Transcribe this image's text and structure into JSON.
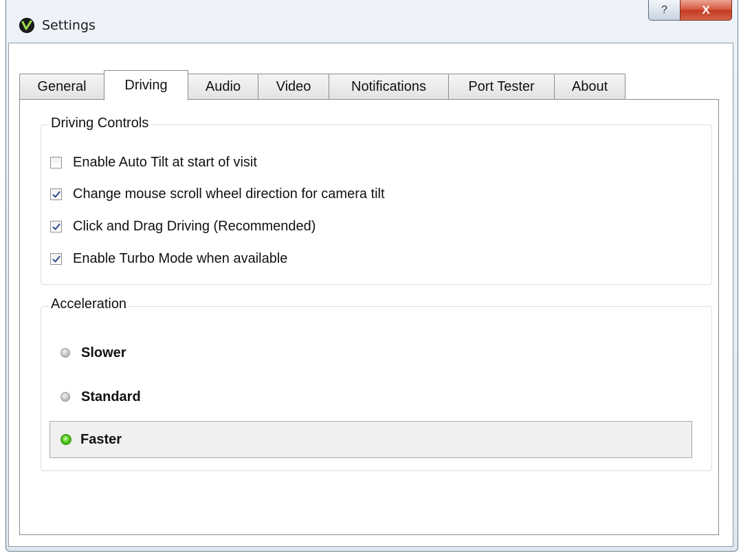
{
  "window": {
    "title": "Settings",
    "help_label": "?",
    "close_label": "X"
  },
  "tabs": [
    {
      "label": "General",
      "active": false
    },
    {
      "label": "Driving",
      "active": true
    },
    {
      "label": "Audio",
      "active": false
    },
    {
      "label": "Video",
      "active": false
    },
    {
      "label": "Notifications",
      "active": false
    },
    {
      "label": "Port Tester",
      "active": false
    },
    {
      "label": "About",
      "active": false
    }
  ],
  "driving_controls": {
    "title": "Driving Controls",
    "options": [
      {
        "label": "Enable Auto Tilt at start of visit",
        "checked": false
      },
      {
        "label": "Change mouse scroll wheel direction for camera tilt",
        "checked": true
      },
      {
        "label": "Click and Drag Driving (Recommended)",
        "checked": true
      },
      {
        "label": "Enable Turbo Mode when available",
        "checked": true
      }
    ]
  },
  "acceleration": {
    "title": "Acceleration",
    "options": [
      {
        "label": "Slower",
        "selected": false
      },
      {
        "label": "Standard",
        "selected": false
      },
      {
        "label": "Faster",
        "selected": true
      }
    ]
  },
  "colors": {
    "selected_radio": "#5fd12b",
    "close_button": "#d8563f",
    "checkmark": "#2c4a8a"
  },
  "icons": {
    "app_icon": "v-logo-icon",
    "help": "question-mark-icon",
    "close": "close-icon"
  }
}
